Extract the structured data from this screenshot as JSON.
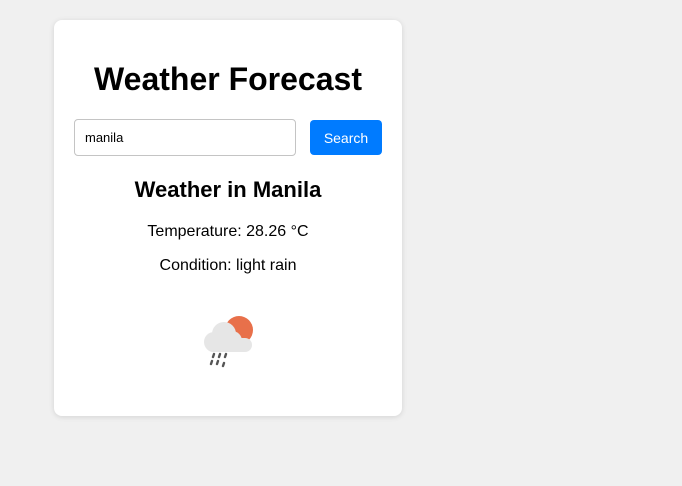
{
  "app": {
    "title": "Weather Forecast"
  },
  "search": {
    "value": "manila",
    "placeholder": "",
    "button_label": "Search"
  },
  "result": {
    "heading": "Weather in Manila",
    "temperature_text": "Temperature: 28.26 °C",
    "condition_text": "Condition: light rain",
    "icon": "sun-cloud-rain-icon"
  },
  "colors": {
    "background": "#f0f0f0",
    "card": "#ffffff",
    "accent": "#007bff",
    "sun": "#e8704a",
    "cloud": "#e6e6e6",
    "rain": "#555555"
  }
}
